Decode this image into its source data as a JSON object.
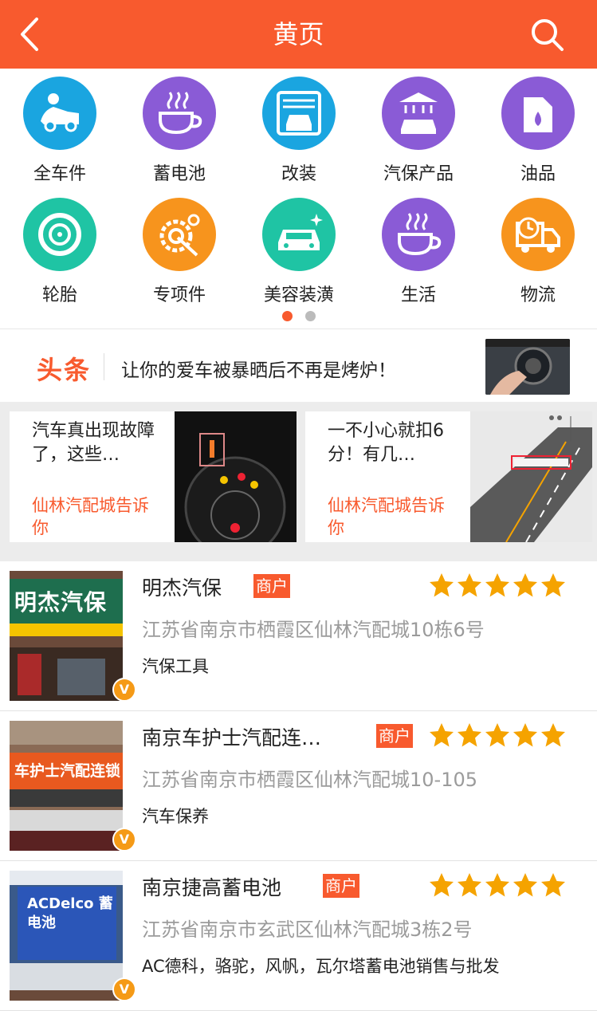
{
  "header": {
    "title": "黄页"
  },
  "categories": [
    {
      "label": "全车件",
      "icon": "mechanic-icon",
      "color": "#1aa5e0"
    },
    {
      "label": "蓄电池",
      "icon": "cup-icon",
      "color": "#8a5bd6"
    },
    {
      "label": "改装",
      "icon": "garage-car-icon",
      "color": "#1aa5e0"
    },
    {
      "label": "汽保产品",
      "icon": "car-wash-icon",
      "color": "#8a5bd6"
    },
    {
      "label": "油品",
      "icon": "oil-can-icon",
      "color": "#8a5bd6"
    },
    {
      "label": "轮胎",
      "icon": "tire-icon",
      "color": "#1fc4a4"
    },
    {
      "label": "专项件",
      "icon": "gear-tool-icon",
      "color": "#f7941d"
    },
    {
      "label": "美容装潢",
      "icon": "sparkle-car-icon",
      "color": "#1fc4a4"
    },
    {
      "label": "生活",
      "icon": "cup-icon",
      "color": "#8a5bd6"
    },
    {
      "label": "物流",
      "icon": "truck-clock-icon",
      "color": "#f7941d"
    }
  ],
  "toutiao": {
    "badge": "头条",
    "text": "让你的爱车被暴晒后不再是烤炉！"
  },
  "news": [
    {
      "title": "汽车真出现故障了，这些…",
      "source": "仙林汽配城告诉你"
    },
    {
      "title": "一不小心就扣6分！有几…",
      "source": "仙林汽配城告诉你"
    }
  ],
  "shops": [
    {
      "name": "明杰汽保",
      "tag": "商户",
      "rating": 5,
      "address": "江苏省南京市栖霞区仙林汽配城10栋6号",
      "desc": "汽保工具",
      "badge": "V",
      "sign": "明杰汽保"
    },
    {
      "name": "南京车护士汽配连…",
      "tag": "商户",
      "rating": 5,
      "address": "江苏省南京市栖霞区仙林汽配城10-105",
      "desc": "汽车保养",
      "badge": "V",
      "sign": "车护士汽配连锁"
    },
    {
      "name": "南京捷高蓄电池",
      "tag": "商户",
      "rating": 5,
      "address": "江苏省南京市玄武区仙林汽配城3栋2号",
      "desc": "AC德科，骆驼，风帆，瓦尔塔蓄电池销售与批发",
      "badge": "V",
      "sign": "ACDelco 蓄电池"
    }
  ],
  "colors": {
    "accent": "#f85a2e",
    "star": "#f5a300"
  }
}
